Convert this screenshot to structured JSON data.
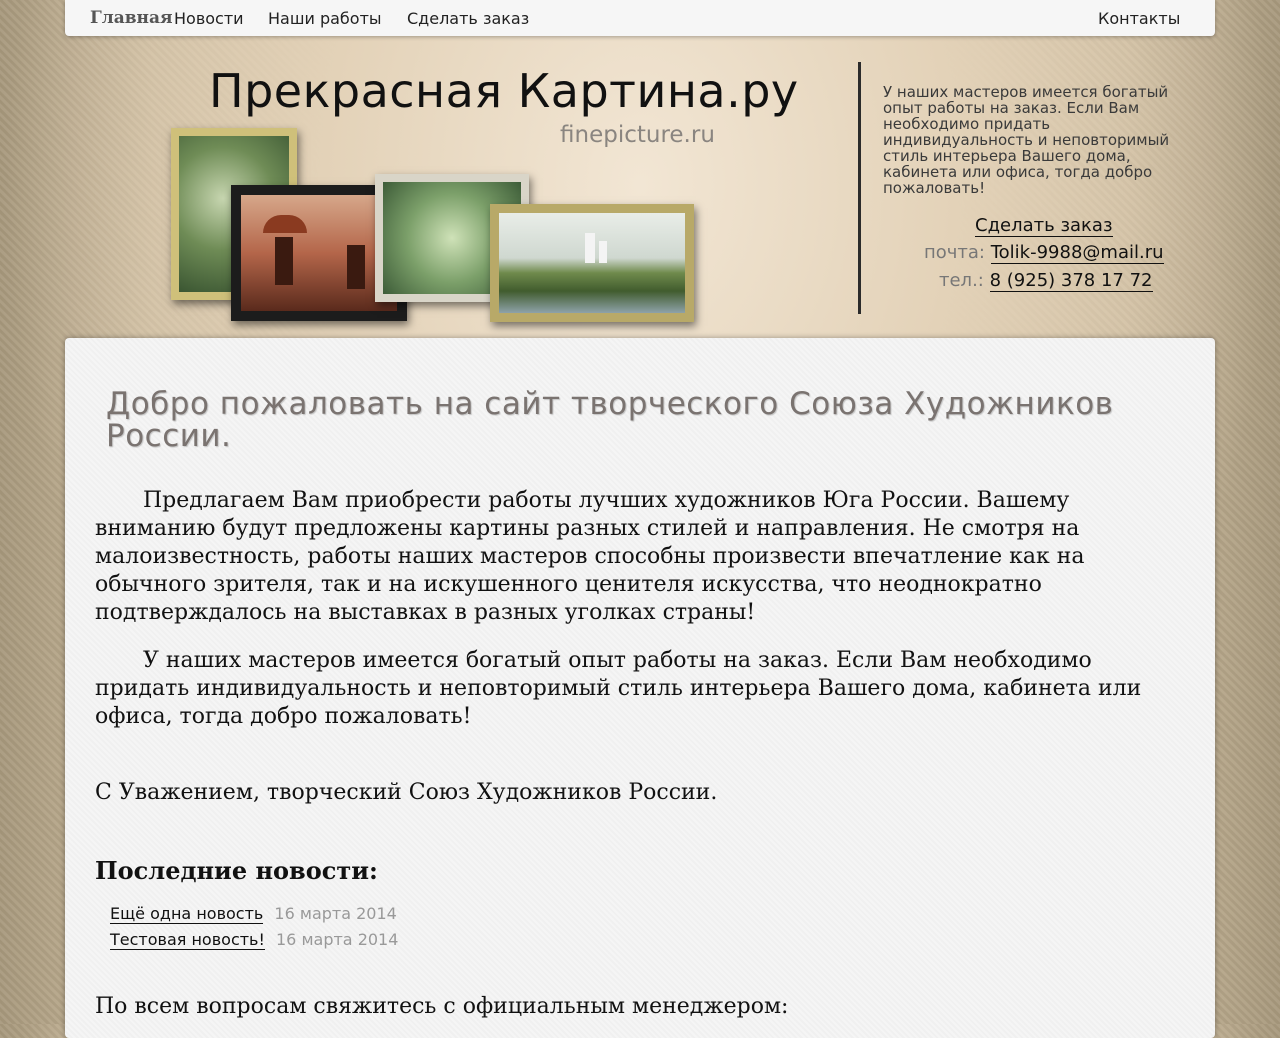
{
  "nav": {
    "brand": "Главная",
    "items": [
      "Новости",
      "Наши работы",
      "Сделать заказ"
    ],
    "contacts": "Контакты"
  },
  "header": {
    "logo_title": "Прекрасная Картина.ру",
    "logo_subtitle": "finepicture.ru",
    "intro": "У наших мастеров имеется богатый опыт работы на заказ. Если Вам необходимо придать индивидуальность и неповторимый стиль интерьера Вашего дома, кабинета или офиса, тогда добро пожаловать!",
    "order_link": "Сделать заказ",
    "email_label": "почта:",
    "email": "Tolik-9988@mail.ru",
    "phone_label": "тел.:",
    "phone": "8 (925) 378 17 72"
  },
  "main": {
    "welcome": "Добро пожаловать на сайт творческого Союза Художников России.",
    "para1": "Предлагаем Вам приобрести работы лучших художников Юга России. Вашему вниманию будут предложены картины разных стилей и направления.   Не смотря на малоизвестность, работы наших мастеров способны произвести впечатление как на обычного зрителя, так и на искушенного ценителя искусства, что неоднократно подтверждалось на выставках в разных уголках страны!",
    "para2": "У наших мастеров имеется богатый опыт работы на заказ. Если Вам необходимо придать индивидуальность и неповторимый стиль интерьера Вашего дома, кабинета или офиса, тогда добро пожаловать!",
    "signature": "С Уважением, творческий Союз Художников России.",
    "news_title": "Последние новости:",
    "news": [
      {
        "title": "Ещё одна новость",
        "date": "16 марта 2014"
      },
      {
        "title": "Тестовая новость!",
        "date": "16 марта 2014"
      }
    ],
    "contact_prompt": "По всем вопросам свяжитесь с официальным менеджером:"
  },
  "colors": {
    "page_bg": "#c9b89b",
    "panel_bg": "#f5f5f5",
    "heading_gray": "#7a7370",
    "date_gray": "#999999"
  }
}
